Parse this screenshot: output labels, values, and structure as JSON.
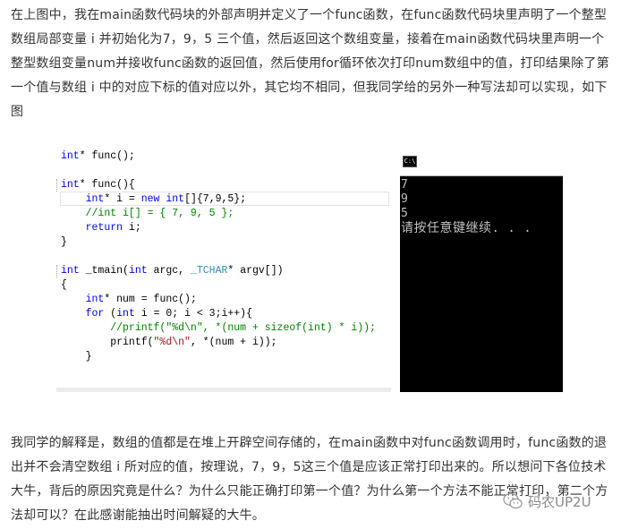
{
  "article": {
    "paragraph1": "在上图中，我在main函数代码块的外部声明并定义了一个func函数，在func函数代码块里声明了一个整型数组局部变量 i 并初始化为7，9，5 三个值，然后返回这个数组变量，接着在main函数代码块里声明一个整型数组变量num并接收func函数的返回值，然后使用for循环依次打印num数组中的值，打印结果除了第一个值与数组 i 中的对应下标的值对应以外，其它均不相同，但我同学给的另外一种写法却可以实现，如下图",
    "paragraph2": "我同学的解释是，数组的值都是在堆上开辟空间存储的，在main函数中对func函数调用时，func函数的退出并不会清空数组 i 所对应的值，按理说，7，9，5这三个值是应该正常打印出来的。所以想问下各位技术大牛，背后的原因究竟是什么？为什么只能正确打印第一个值？为什么第一个方法不能正常打印，第二个方法却可以？在此感谢能抽出时间解疑的大牛。"
  },
  "code": {
    "line1": [
      "int* func();"
    ],
    "line2_kw": "int",
    "line2_rest": "* func(){",
    "line3_a": "int",
    "line3_b": "* i = ",
    "line3_c": "new",
    "line3_d": " ",
    "line3_e": "int",
    "line3_f": "[]{7,9,5};",
    "line4": "//int i[] = { 7, 9, 5 };",
    "line5_kw": "return",
    "line5_rest": " i;",
    "line6": "}",
    "line7_kw": "int",
    "line7_fn": " _tmain(",
    "line7_kw2": "int",
    "line7_mid": " argc, ",
    "line7_type": "_TCHAR",
    "line7_end": "* argv[])",
    "line8": "{",
    "line9_kw": "int",
    "line9_rest": "* num = func();",
    "line10_kw": "for",
    "line10_a": " (",
    "line10_kw2": "int",
    "line10_b": " i = 0; i < 3;i++){",
    "line11_a": "//printf(\"%d\\n\", *(num + sizeof(int) * i));",
    "line12_a": "printf(",
    "line12_str": "\"%d\\n\"",
    "line12_b": ", *(num + i));",
    "line13": "}"
  },
  "console": {
    "icon_label": "C:\\",
    "lines": [
      "7",
      "9",
      "5"
    ],
    "prompt": "请按任意键继续. . ."
  },
  "watermark": {
    "text": "码农UP2U"
  }
}
